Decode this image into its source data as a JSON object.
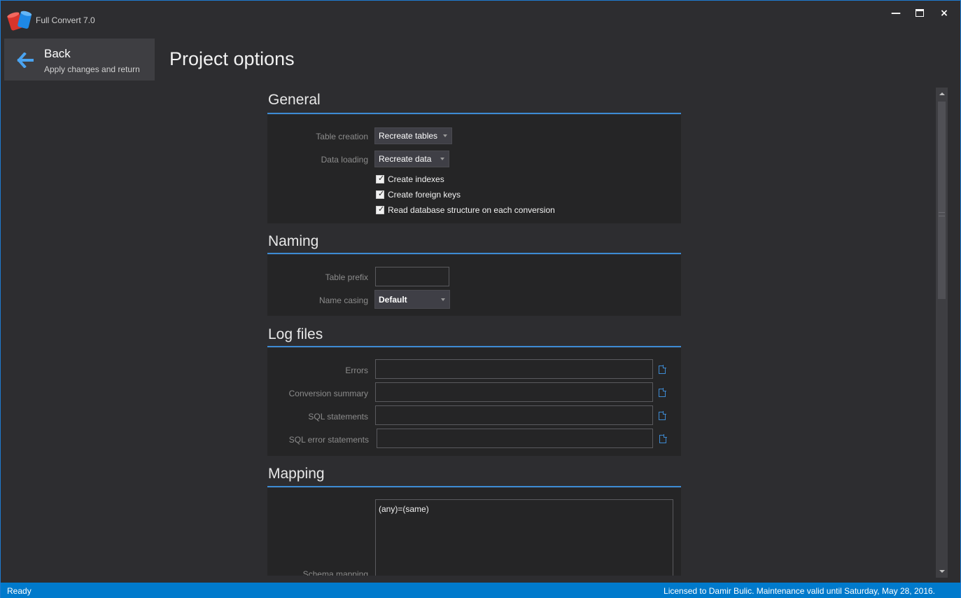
{
  "window": {
    "title": "Full Convert 7.0",
    "accent_color": "#007acc",
    "controls": [
      "minimize-icon",
      "maximize-icon",
      "close-icon"
    ]
  },
  "back": {
    "label": "Back",
    "sublabel": "Apply changes and return",
    "icon": "arrow-left-icon"
  },
  "page": {
    "title": "Project options"
  },
  "general": {
    "title": "General",
    "table_creation_label": "Table creation",
    "table_creation_value": "Recreate tables",
    "data_loading_label": "Data loading",
    "data_loading_value": "Recreate data",
    "checkboxes": [
      {
        "label": "Create indexes",
        "checked": true
      },
      {
        "label": "Create foreign keys",
        "checked": true
      },
      {
        "label": "Read database structure on each conversion",
        "checked": true
      }
    ]
  },
  "naming": {
    "title": "Naming",
    "table_prefix_label": "Table prefix",
    "table_prefix_value": "",
    "name_casing_label": "Name casing",
    "name_casing_value": "Default"
  },
  "log_files": {
    "title": "Log files",
    "fields": [
      {
        "label": "Errors",
        "value": ""
      },
      {
        "label": "Conversion summary",
        "value": ""
      },
      {
        "label": "SQL statements",
        "value": ""
      },
      {
        "label": "SQL error statements",
        "value": ""
      }
    ]
  },
  "mapping": {
    "title": "Mapping",
    "schema_mapping_label": "Schema mapping",
    "schema_mapping_value": "(any)=(same)"
  },
  "status": {
    "left": "Ready",
    "right": "Licensed to Damir Bulic. Maintenance valid until Saturday, May 28, 2016."
  }
}
